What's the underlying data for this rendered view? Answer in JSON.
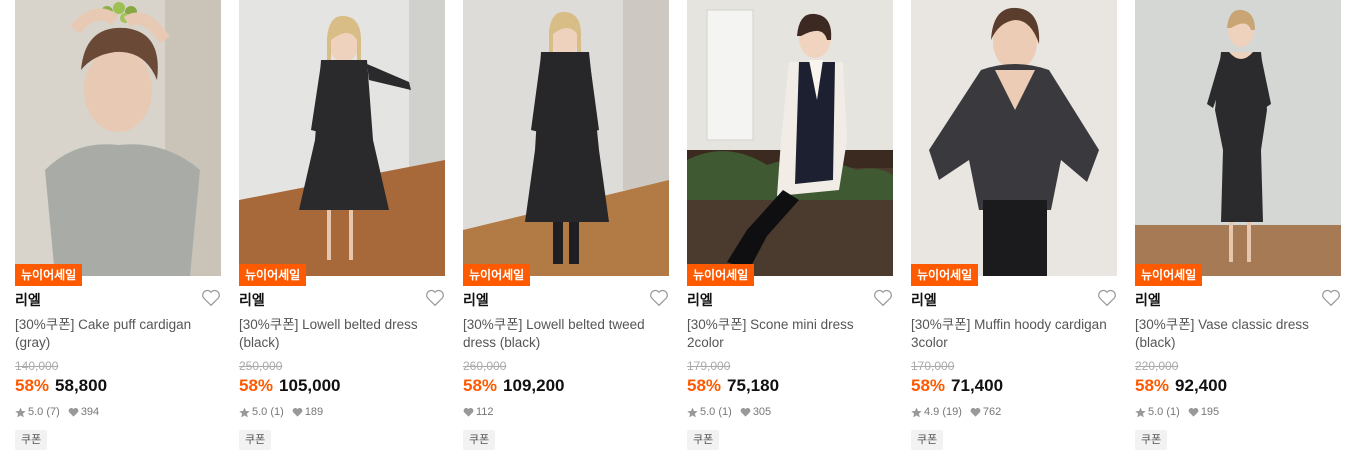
{
  "badge_label": "뉴이어세일",
  "coupon_label": "쿠폰",
  "colors": {
    "accent": "#ff5a00",
    "text": "#111111",
    "muted": "#777777"
  },
  "products": [
    {
      "brand": "리엘",
      "name": "[30%쿠폰] Cake puff cardigan (gray)",
      "original_price": "140,000",
      "discount": "58%",
      "price": "58,800",
      "rating": "5.0",
      "reviews": "(7)",
      "likes": "394"
    },
    {
      "brand": "리엘",
      "name": "[30%쿠폰] Lowell belted dress (black)",
      "original_price": "250,000",
      "discount": "58%",
      "price": "105,000",
      "rating": "5.0",
      "reviews": "(1)",
      "likes": "189"
    },
    {
      "brand": "리엘",
      "name": "[30%쿠폰] Lowell belted tweed dress (black)",
      "original_price": "260,000",
      "discount": "58%",
      "price": "109,200",
      "rating": "",
      "reviews": "",
      "likes": "112"
    },
    {
      "brand": "리엘",
      "name": "[30%쿠폰] Scone mini dress 2color",
      "original_price": "179,000",
      "discount": "58%",
      "price": "75,180",
      "rating": "5.0",
      "reviews": "(1)",
      "likes": "305"
    },
    {
      "brand": "리엘",
      "name": "[30%쿠폰] Muffin hoody cardigan 3color",
      "original_price": "170,000",
      "discount": "58%",
      "price": "71,400",
      "rating": "4.9",
      "reviews": "(19)",
      "likes": "762"
    },
    {
      "brand": "리엘",
      "name": "[30%쿠폰] Vase classic dress (black)",
      "original_price": "220,000",
      "discount": "58%",
      "price": "92,400",
      "rating": "5.0",
      "reviews": "(1)",
      "likes": "195"
    }
  ]
}
